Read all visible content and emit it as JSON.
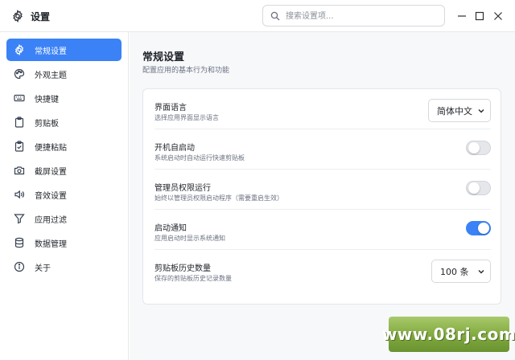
{
  "app": {
    "title": "设置",
    "icon": "gear-icon"
  },
  "search": {
    "placeholder": "搜索设置项..."
  },
  "window_controls": [
    "minimize-icon",
    "maximize-icon",
    "close-icon"
  ],
  "sidebar": {
    "items": [
      {
        "label": "常规设置",
        "icon": "gear-icon",
        "active": true
      },
      {
        "label": "外观主题",
        "icon": "palette-icon",
        "active": false
      },
      {
        "label": "快捷键",
        "icon": "keyboard-icon",
        "active": false
      },
      {
        "label": "剪贴板",
        "icon": "clipboard-icon",
        "active": false
      },
      {
        "label": "便捷粘贴",
        "icon": "clipboard-check-icon",
        "active": false
      },
      {
        "label": "截屏设置",
        "icon": "camera-icon",
        "active": false
      },
      {
        "label": "音效设置",
        "icon": "speaker-icon",
        "active": false
      },
      {
        "label": "应用过滤",
        "icon": "filter-icon",
        "active": false
      },
      {
        "label": "数据管理",
        "icon": "database-icon",
        "active": false
      },
      {
        "label": "关于",
        "icon": "info-icon",
        "active": false
      }
    ]
  },
  "main": {
    "title": "常规设置",
    "subtitle": "配置应用的基本行为和功能",
    "settings": [
      {
        "title": "界面语言",
        "desc": "选择应用界面显示语言",
        "control": "select",
        "value": "简体中文"
      },
      {
        "title": "开机自启动",
        "desc": "系统启动时自动运行快速剪贴板",
        "control": "toggle",
        "on": false
      },
      {
        "title": "管理员权限运行",
        "desc": "始终以管理员权限启动程序（需要重启生效）",
        "control": "toggle",
        "on": false
      },
      {
        "title": "启动通知",
        "desc": "应用启动时显示系统通知",
        "control": "toggle",
        "on": true
      },
      {
        "title": "剪贴板历史数量",
        "desc": "保存的剪贴板历史记录数量",
        "control": "select",
        "value": "100 条"
      }
    ]
  },
  "colors": {
    "accent": "#3b82f6",
    "background": "#f7f8fa"
  },
  "watermark": {
    "text": "www.08rj.com"
  }
}
